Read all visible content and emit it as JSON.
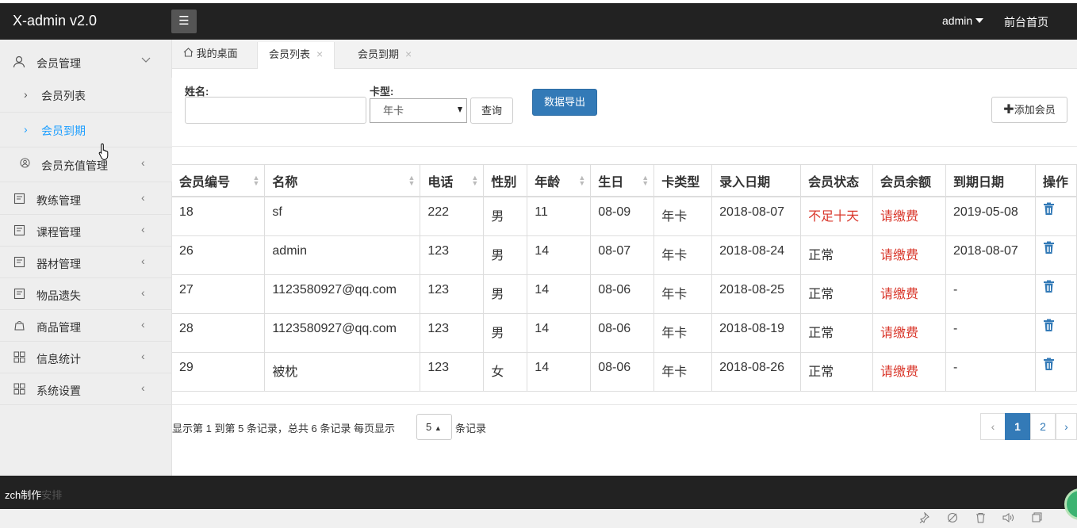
{
  "app": {
    "title": "X-admin v2.0"
  },
  "header": {
    "user": "admin",
    "front_link": "前台首页"
  },
  "sidebar": {
    "member_mgmt": "会员管理",
    "sub_list": "会员列表",
    "sub_expire": "会员到期",
    "sub_recharge": "会员充值管理",
    "items": [
      "教练管理",
      "课程管理",
      "器材管理",
      "物品遗失",
      "商品管理",
      "信息统计",
      "系统设置"
    ]
  },
  "tabs": [
    "我的桌面",
    "会员列表",
    "会员到期"
  ],
  "filter": {
    "name_label": "姓名:",
    "card_label": "卡型:",
    "card_value": "年卡",
    "query": "查询",
    "export": "数据导出",
    "add": "添加会员"
  },
  "table": {
    "headers": [
      "会员编号",
      "名称",
      "电话",
      "性别",
      "年龄",
      "生日",
      "卡类型",
      "录入日期",
      "会员状态",
      "会员余额",
      "到期日期",
      "操作"
    ],
    "rows": [
      [
        "18",
        "sf",
        "222",
        "男",
        "11",
        "08-09",
        "年卡",
        "2018-08-07",
        "不足十天",
        "请缴费",
        "2019-05-08"
      ],
      [
        "26",
        "admin",
        "123",
        "男",
        "14",
        "08-07",
        "年卡",
        "2018-08-24",
        "正常",
        "请缴费",
        "2018-08-07"
      ],
      [
        "27",
        "1123580927@qq.com",
        "123",
        "男",
        "14",
        "08-06",
        "年卡",
        "2018-08-25",
        "正常",
        "请缴费",
        "-"
      ],
      [
        "28",
        "1123580927@qq.com",
        "123",
        "男",
        "14",
        "08-06",
        "年卡",
        "2018-08-19",
        "正常",
        "请缴费",
        "-"
      ],
      [
        "29",
        "被枕",
        "123",
        "女",
        "14",
        "08-06",
        "年卡",
        "2018-08-26",
        "正常",
        "请缴费",
        "-"
      ]
    ]
  },
  "pagination": {
    "info": "显示第 1 到第 5 条记录，总共 6 条记录 每页显示",
    "page_size": "5",
    "after": "条记录",
    "prev": "‹",
    "pages": [
      "1",
      "2"
    ],
    "next": "›"
  },
  "footer": {
    "text": "zch制作",
    "ghost": "安排"
  },
  "colors": {
    "topbar": "#222222",
    "sidebar": "#eeeeee",
    "accent": "#337ab7",
    "active_link": "#1e9fff",
    "warn": "#d9372b"
  }
}
